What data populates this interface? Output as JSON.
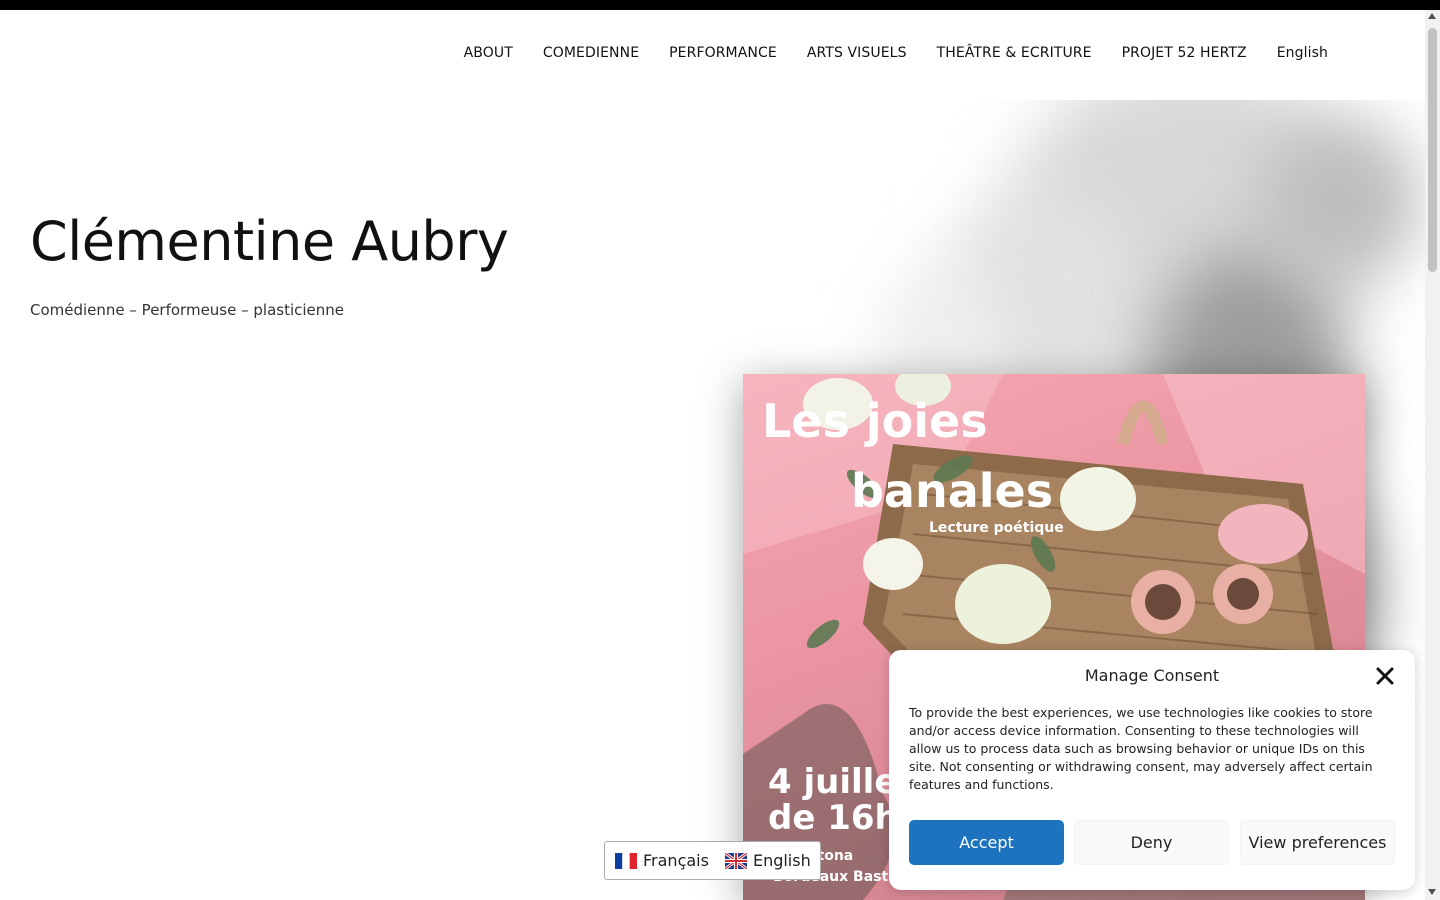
{
  "nav": {
    "items": [
      {
        "label": "ABOUT"
      },
      {
        "label": "COMEDIENNE"
      },
      {
        "label": "PERFORMANCE"
      },
      {
        "label": "ARTS VISUELS"
      },
      {
        "label": "THEÂTRE & ECRITURE"
      },
      {
        "label": "PROJET 52 HERTZ"
      },
      {
        "label": "English"
      }
    ]
  },
  "hero": {
    "title": "Clémentine Aubry",
    "subtitle": "Comédienne – Performeuse – plasticienne"
  },
  "poster": {
    "title_line1": "Les joies",
    "title_line2": "banales",
    "subtitle": "Lecture poétique",
    "date_line1": "4 juille",
    "date_line2": "de 16h",
    "place_line1": "n Cantona",
    "place_line2": "Bordeaux Basti"
  },
  "language_switcher": {
    "items": [
      {
        "label": "Français",
        "flag": "france-flag-icon"
      },
      {
        "label": "English",
        "flag": "uk-flag-icon"
      }
    ]
  },
  "consent": {
    "title": "Manage Consent",
    "body": "To provide the best experiences, we use technologies like cookies to store and/or access device information. Consenting to these technologies will allow us to process data such as browsing behavior or unique IDs on this site. Not consenting or withdrawing consent, may adversely affect certain features and functions.",
    "accept_label": "Accept",
    "deny_label": "Deny",
    "preferences_label": "View preferences",
    "accent_color": "#1e73be"
  }
}
